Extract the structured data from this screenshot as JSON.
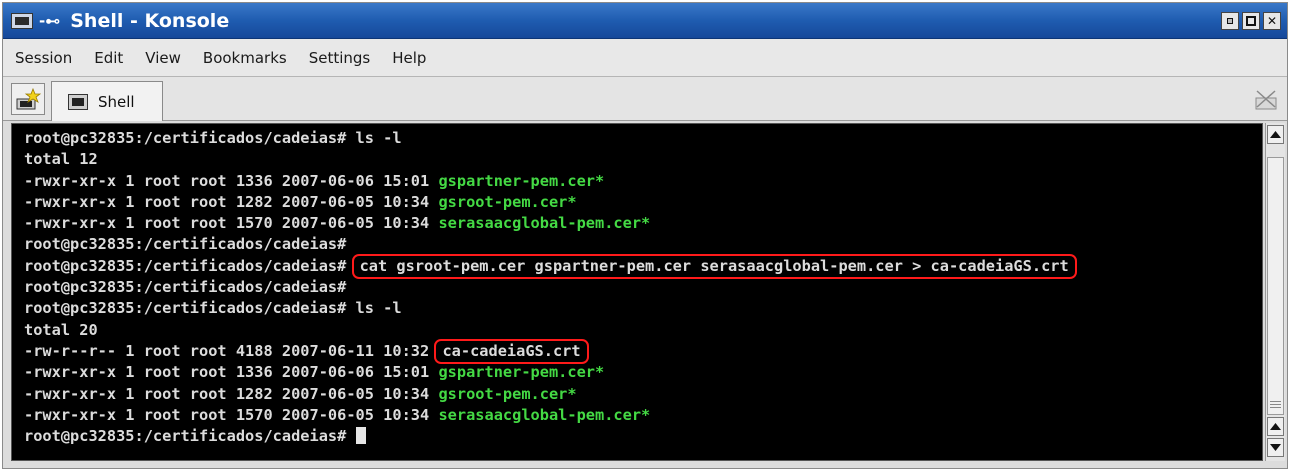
{
  "window": {
    "title": "Shell - Konsole"
  },
  "menu": [
    {
      "label": "Session"
    },
    {
      "label": "Edit"
    },
    {
      "label": "View"
    },
    {
      "label": "Bookmarks"
    },
    {
      "label": "Settings"
    },
    {
      "label": "Help"
    }
  ],
  "tabs": [
    {
      "label": "Shell",
      "icon": "terminal-icon"
    }
  ],
  "terminal": {
    "prompt": "root@pc32835:/certificados/cadeias#",
    "lines": [
      {
        "kind": "cmd",
        "command": " ls -l"
      },
      {
        "kind": "text",
        "text": "total 12"
      },
      {
        "kind": "file",
        "meta": "-rwxr-xr-x 1 root root 1336 2007-06-06 15:01 ",
        "name": "gspartner-pem.cer*"
      },
      {
        "kind": "file",
        "meta": "-rwxr-xr-x 1 root root 1282 2007-06-05 10:34 ",
        "name": "gsroot-pem.cer*"
      },
      {
        "kind": "file",
        "meta": "-rwxr-xr-x 1 root root 1570 2007-06-05 10:34 ",
        "name": "serasaacglobal-pem.cer*"
      },
      {
        "kind": "cmd",
        "command": ""
      },
      {
        "kind": "cmd",
        "command": "cat gsroot-pem.cer gspartner-pem.cer serasaacglobal-pem.cer > ca-cadeiaGS.crt",
        "highlight": true
      },
      {
        "kind": "cmd",
        "command": ""
      },
      {
        "kind": "cmd",
        "command": " ls -l"
      },
      {
        "kind": "text",
        "text": "total 20"
      },
      {
        "kind": "plainfile",
        "meta": "-rw-r--r-- 1 root root 4188 2007-06-11 10:32 ",
        "name": "ca-cadeiaGS.crt",
        "highlight": true
      },
      {
        "kind": "file",
        "meta": "-rwxr-xr-x 1 root root 1336 2007-06-06 15:01 ",
        "name": "gspartner-pem.cer*"
      },
      {
        "kind": "file",
        "meta": "-rwxr-xr-x 1 root root 1282 2007-06-05 10:34 ",
        "name": "gsroot-pem.cer*"
      },
      {
        "kind": "file",
        "meta": "-rwxr-xr-x 1 root root 1570 2007-06-05 10:34 ",
        "name": "serasaacglobal-pem.cer*"
      },
      {
        "kind": "cursor",
        "command": " "
      }
    ]
  },
  "colors": {
    "titlebar": "#1f5cb0",
    "terminal_bg": "#000000",
    "terminal_fg": "#dcdcdc",
    "executable": "#44d944",
    "highlight_box": "#ff1a1a"
  }
}
